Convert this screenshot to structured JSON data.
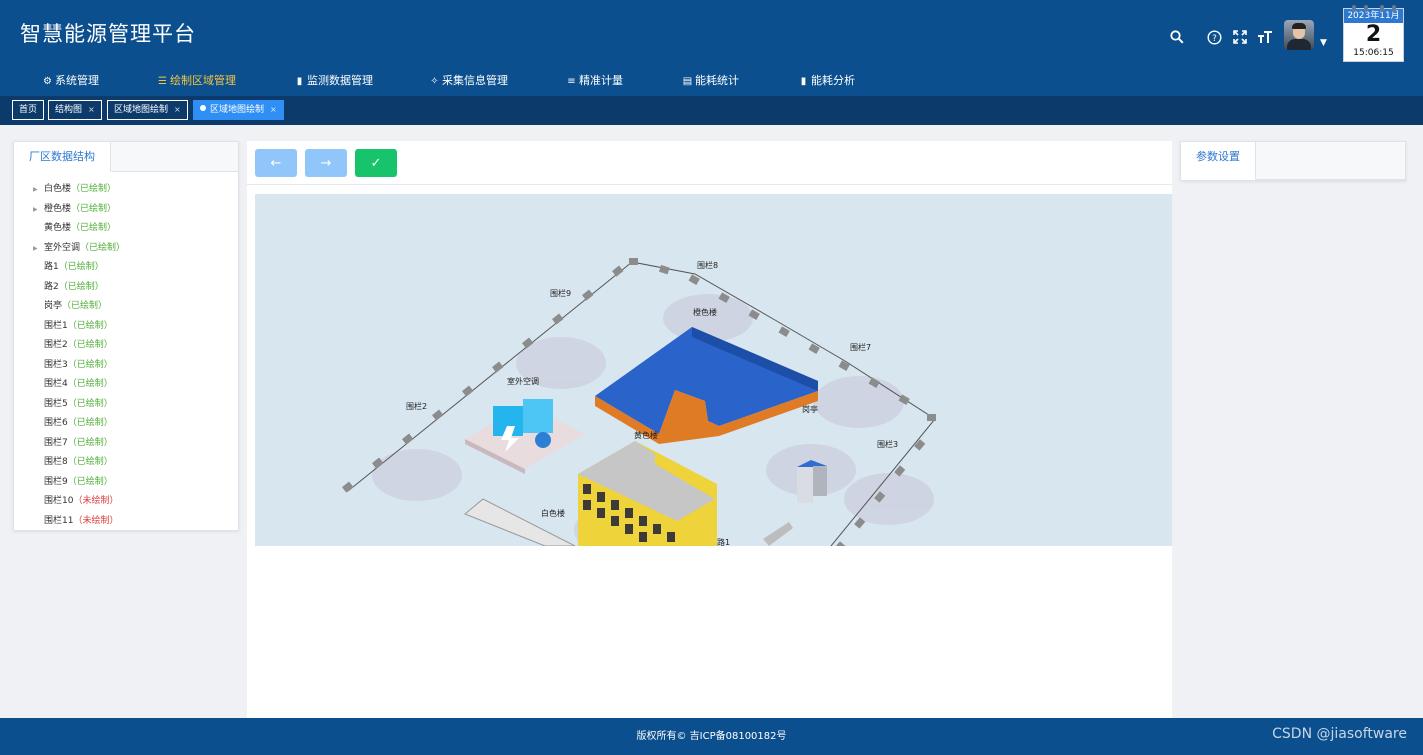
{
  "app": {
    "title": "智慧能源管理平台"
  },
  "header": {
    "icons": [
      "search-icon",
      "help-icon",
      "fullscreen-icon",
      "font-size-icon"
    ],
    "calendar": {
      "month": "2023年11月",
      "day": "2",
      "time": "15:06:15"
    }
  },
  "nav": {
    "items": [
      {
        "label": "系统管理",
        "icon": "gear-icon"
      },
      {
        "label": "绘制区域管理",
        "icon": "draw-list-icon"
      },
      {
        "label": "监测数据管理",
        "icon": "bar-chart-icon"
      },
      {
        "label": "采集信息管理",
        "icon": "collect-icon"
      },
      {
        "label": "精准计量",
        "icon": "sliders-icon"
      },
      {
        "label": "能耗统计",
        "icon": "stats-icon"
      },
      {
        "label": "能耗分析",
        "icon": "bar-chart-icon"
      }
    ],
    "active": "绘制区域管理"
  },
  "tabs": [
    {
      "label": "首页"
    },
    {
      "label": "结构图",
      "close": "×"
    },
    {
      "label": "区域地图绘制",
      "close": "×"
    },
    {
      "label": "区域地图绘制",
      "close": "×",
      "active": true
    }
  ],
  "left_panel": {
    "tab": "厂区数据结构",
    "tree": [
      {
        "name": "白色楼",
        "status": "（已绘制）",
        "done": true,
        "expandable": true
      },
      {
        "name": "橙色楼",
        "status": "（已绘制）",
        "done": true,
        "expandable": true
      },
      {
        "name": "黄色楼",
        "status": "（已绘制）",
        "done": true,
        "expandable": false
      },
      {
        "name": "室外空调",
        "status": "（已绘制）",
        "done": true,
        "expandable": true
      },
      {
        "name": "路1",
        "status": "（已绘制）",
        "done": true,
        "expandable": false
      },
      {
        "name": "路2",
        "status": "（已绘制）",
        "done": true,
        "expandable": false
      },
      {
        "name": "岗亭",
        "status": "（已绘制）",
        "done": true,
        "expandable": false
      },
      {
        "name": "围栏1",
        "status": "（已绘制）",
        "done": true,
        "expandable": false
      },
      {
        "name": "围栏2",
        "status": "（已绘制）",
        "done": true,
        "expandable": false
      },
      {
        "name": "围栏3",
        "status": "（已绘制）",
        "done": true,
        "expandable": false
      },
      {
        "name": "围栏4",
        "status": "（已绘制）",
        "done": true,
        "expandable": false
      },
      {
        "name": "围栏5",
        "status": "（已绘制）",
        "done": true,
        "expandable": false
      },
      {
        "name": "围栏6",
        "status": "（已绘制）",
        "done": true,
        "expandable": false
      },
      {
        "name": "围栏7",
        "status": "（已绘制）",
        "done": true,
        "expandable": false
      },
      {
        "name": "围栏8",
        "status": "（已绘制）",
        "done": true,
        "expandable": false
      },
      {
        "name": "围栏9",
        "status": "（已绘制）",
        "done": true,
        "expandable": false
      },
      {
        "name": "围栏10",
        "status": "（未绘制）",
        "done": false,
        "expandable": false
      },
      {
        "name": "围栏11",
        "status": "（未绘制）",
        "done": false,
        "expandable": false
      }
    ]
  },
  "toolbar": {
    "back_icon": "←",
    "forward_icon": "→",
    "confirm_icon": "✓",
    "colors": {
      "disabled_blue": "#90c6fa",
      "confirm_green": "#18c46b"
    }
  },
  "map": {
    "labels": {
      "fence8": "围栏8",
      "fence9": "围栏9",
      "fence7": "围栏7",
      "fence2": "围栏2",
      "fence3": "围栏3",
      "orange_building": "橙色楼",
      "outdoor_ac": "室外空调",
      "guard_booth": "岗亭",
      "yellow_building": "黄色楼",
      "white_building": "白色楼",
      "road1": "路1"
    }
  },
  "right_panel": {
    "tab": "参数设置"
  },
  "footer": {
    "copyright": "版权所有© 吉ICP备08100182号",
    "watermark": "CSDN @jiasoftware"
  }
}
